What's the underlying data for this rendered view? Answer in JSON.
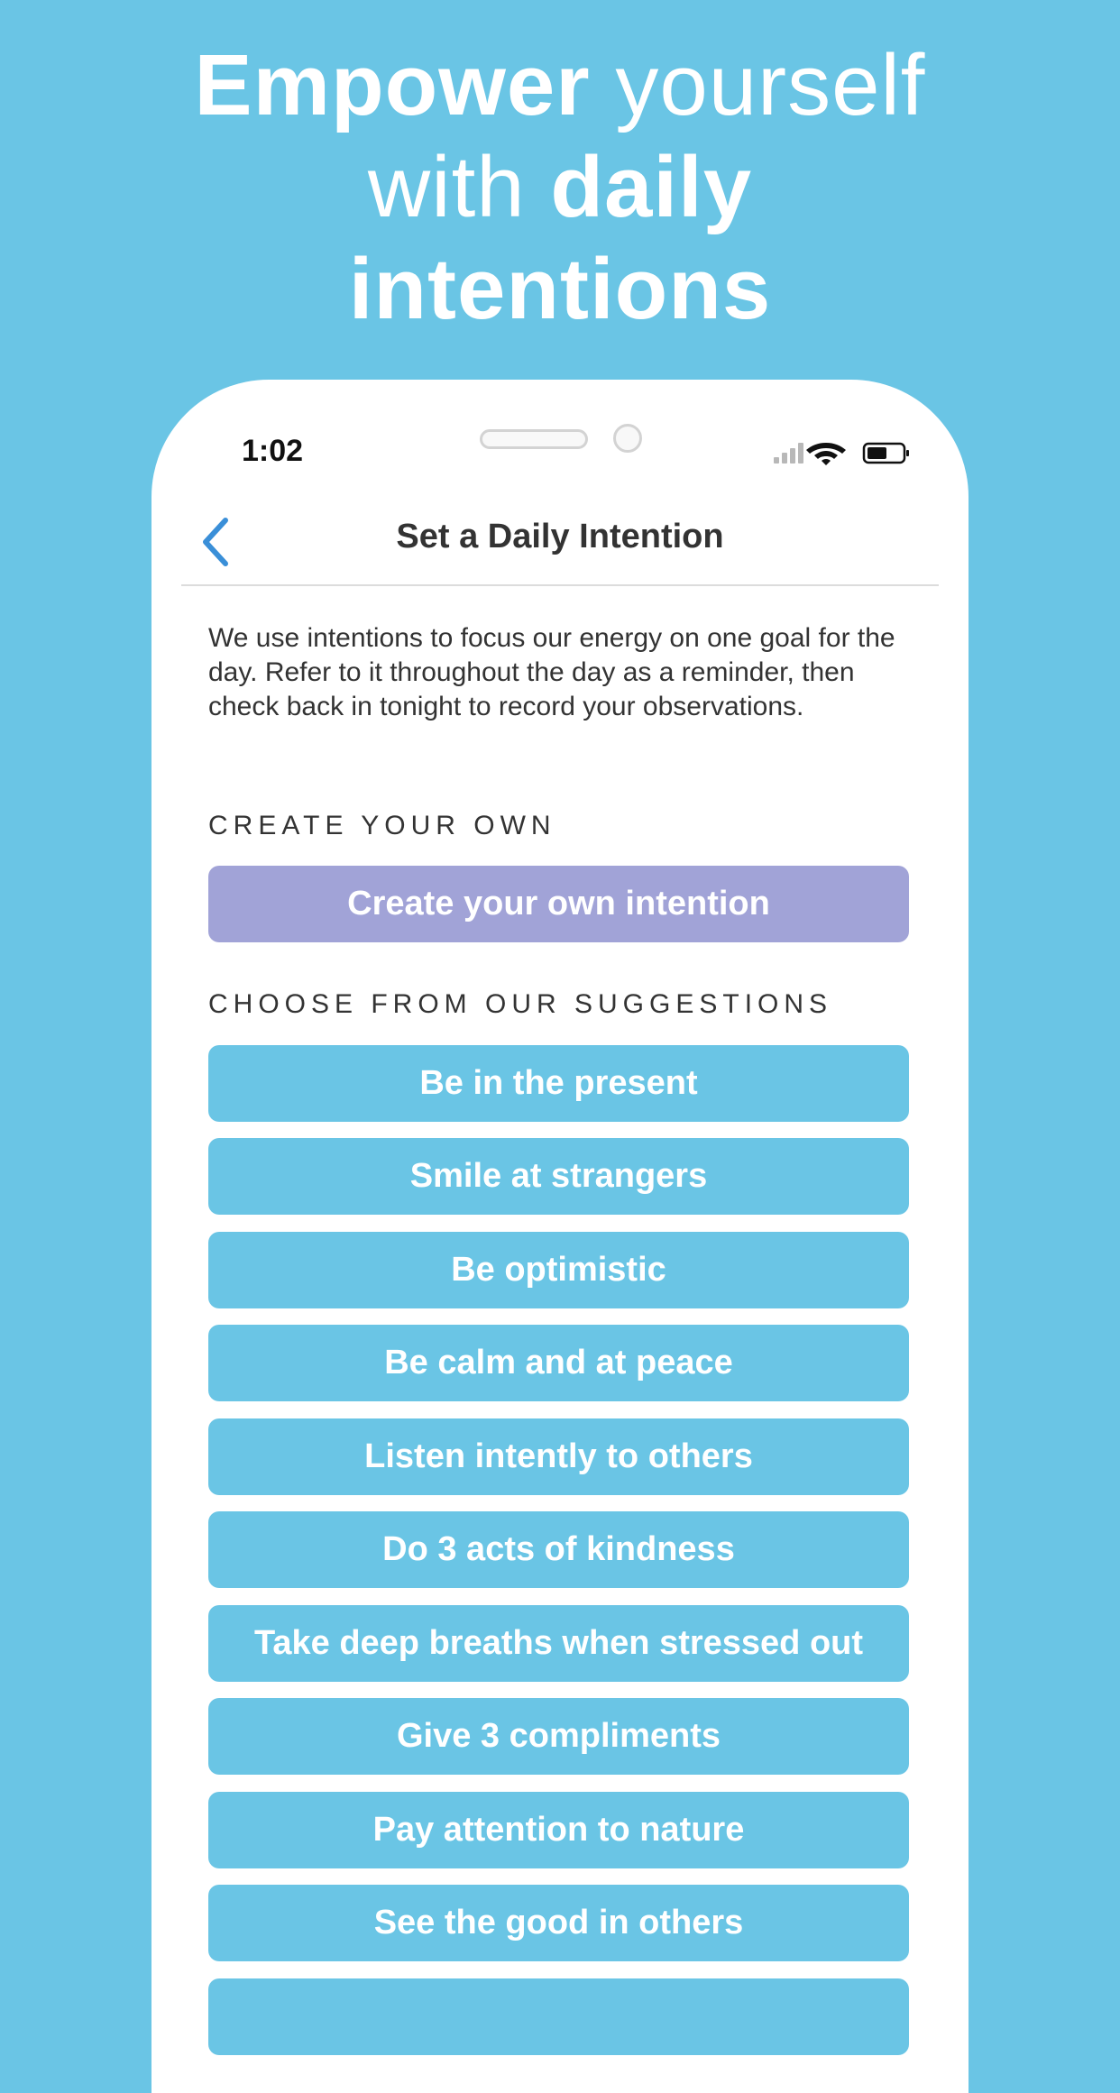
{
  "headline": {
    "line1_bold": "Empower",
    "line1_light": "yourself",
    "line2_light": "with",
    "line2_bold": "daily",
    "line3_bold": "intentions"
  },
  "status_bar": {
    "time": "1:02"
  },
  "nav": {
    "title": "Set a Daily Intention"
  },
  "intro_text": "We use intentions to focus our energy on one goal for the day. Refer to it throughout the day as a reminder, then check back in tonight to record your observations.",
  "create_section": {
    "label": "CREATE YOUR OWN",
    "button_label": "Create your own intention"
  },
  "suggestions_section": {
    "label": "CHOOSE FROM OUR SUGGESTIONS",
    "items": [
      "Be in the present",
      "Smile at strangers",
      "Be optimistic",
      "Be calm and at peace",
      "Listen intently to others",
      "Do 3 acts of kindness",
      "Take deep breaths when stressed out",
      "Give 3 compliments",
      "Pay attention to nature",
      "See the good in others",
      ""
    ]
  },
  "colors": {
    "background": "#6ac5e5",
    "create_button": "#a1a3d7",
    "suggestion_button": "#6ac5e5",
    "accent_back": "#3a8fd8"
  }
}
